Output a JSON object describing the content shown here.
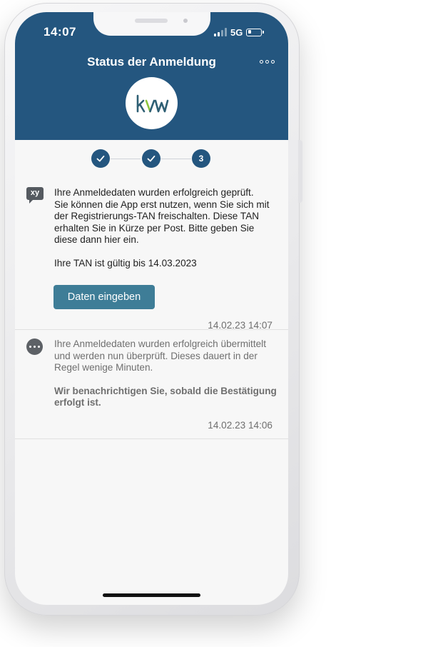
{
  "status_bar": {
    "time": "14:07",
    "network": "5G",
    "battery_level": 0.25
  },
  "header": {
    "title": "Status der Anmeldung",
    "more_icon": "more-horizontal-icon",
    "logo_text": "kvw",
    "colors": {
      "header_bg": "#24567f",
      "logo_dark": "#2e5f74",
      "logo_accent": "#8cc63f"
    }
  },
  "stepper": {
    "steps": [
      {
        "state": "done",
        "icon": "check-icon"
      },
      {
        "state": "done",
        "icon": "check-icon"
      },
      {
        "state": "current",
        "label": "3"
      }
    ]
  },
  "messages": [
    {
      "icon": "xy",
      "text": [
        "Ihre Anmeldedaten wurden erfolgreich geprüft.",
        "Sie können die App erst nutzen, wenn Sie sich mit",
        "der Registrierungs-TAN freischalten. Diese TAN",
        "erhalten Sie in Kürze per Post. Bitte geben Sie",
        "diese dann hier ein."
      ],
      "validity": "Ihre TAN ist gültig bis 14.03.2023",
      "button_label": "Daten eingeben",
      "timestamp": "14.02.23 14:07"
    },
    {
      "icon": "dots-icon",
      "text": [
        "Ihre Anmeldedaten wurden erfolgreich übermittelt",
        "und werden nun überprüft. Dieses dauert in der",
        "Regel wenige Minuten."
      ],
      "bold_text": [
        "Wir benachrichtigen Sie, sobald die Bestätigung",
        "erfolgt ist."
      ],
      "timestamp": "14.02.23 14:06"
    }
  ]
}
